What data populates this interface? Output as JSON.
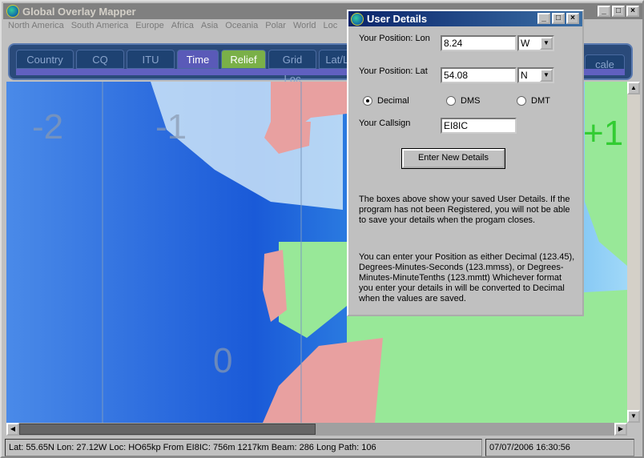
{
  "window": {
    "title": "Global Overlay Mapper",
    "controls": [
      "_",
      "□",
      "×"
    ]
  },
  "menu": [
    "North America",
    "South America",
    "Europe",
    "Africa",
    "Asia",
    "Oceania",
    "Polar",
    "World",
    "Loc"
  ],
  "tabs": [
    "Country",
    "CQ",
    "ITU",
    "Time",
    "Relief",
    "Grid Loc",
    "Lat/Lon"
  ],
  "toolbar_partial": "cale",
  "map": {
    "zones": [
      "-2",
      "-1",
      "0",
      "+1"
    ]
  },
  "status": {
    "info": "Lat: 55.65N  Lon: 27.12W  Loc: HO65kp  From EI8IC: 756m  1217km  Beam: 286  Long Path: 106",
    "datetime": "07/07/2006 16:30:56"
  },
  "dialog": {
    "title": "User Details",
    "lon_label": "Your Position: Lon",
    "lon_value": "8.24",
    "lon_dir": "W",
    "lat_label": "Your Position: Lat",
    "lat_value": "54.08",
    "lat_dir": "N",
    "formats": [
      "Decimal",
      "DMS",
      "DMT"
    ],
    "selected_format": "Decimal",
    "callsign_label": "Your Callsign",
    "callsign_value": "EI8IC",
    "button": "Enter New Details",
    "para1": "The boxes above show your saved User Details. If the program has not been Registered, you will not be able to save your details when the progam closes.",
    "para2": "You can enter your Position as either Decimal (123.45),  Degrees-Minutes-Seconds  (123.mmss),  or  Degrees-Minutes-MinuteTenths  (123.mmtt) Whichever format you enter your details in will be converted to Decimal when the values are saved."
  }
}
